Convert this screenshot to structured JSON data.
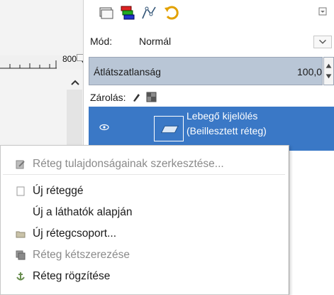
{
  "ruler": {
    "label": "800"
  },
  "layers_dialog": {
    "tabs": [
      "layers-tab",
      "channels-tab",
      "paths-tab",
      "undo-tab"
    ],
    "mode": {
      "label": "Mód:",
      "value": "Normál"
    },
    "opacity": {
      "label": "Átlátszatlanság",
      "value": "100,0",
      "level_percent": 100
    },
    "lock": {
      "label": "Zárolás:"
    },
    "selected_layer": {
      "line1": "Lebegő kijelölés",
      "line2": "(Beillesztett réteg)"
    }
  },
  "context_menu": {
    "items": [
      {
        "text": "Réteg tulajdonságainak szerkesztése...",
        "icon": "edit-layer-icon",
        "enabled": false
      },
      {
        "text": "Új réteggé",
        "icon": "new-layer-icon",
        "enabled": true
      },
      {
        "text": "Új a láthatók alapján",
        "icon": "",
        "enabled": true
      },
      {
        "text": "Új rétegcsoport...",
        "icon": "folder-icon",
        "enabled": true
      },
      {
        "text": "Réteg kétszerezése",
        "icon": "duplicate-layer-icon",
        "enabled": false
      },
      {
        "text": "Réteg rögzítése",
        "icon": "anchor-icon",
        "enabled": true
      }
    ]
  },
  "colors": {
    "selection": "#3a78c6",
    "opacity_fill": "#b9c6d6"
  }
}
